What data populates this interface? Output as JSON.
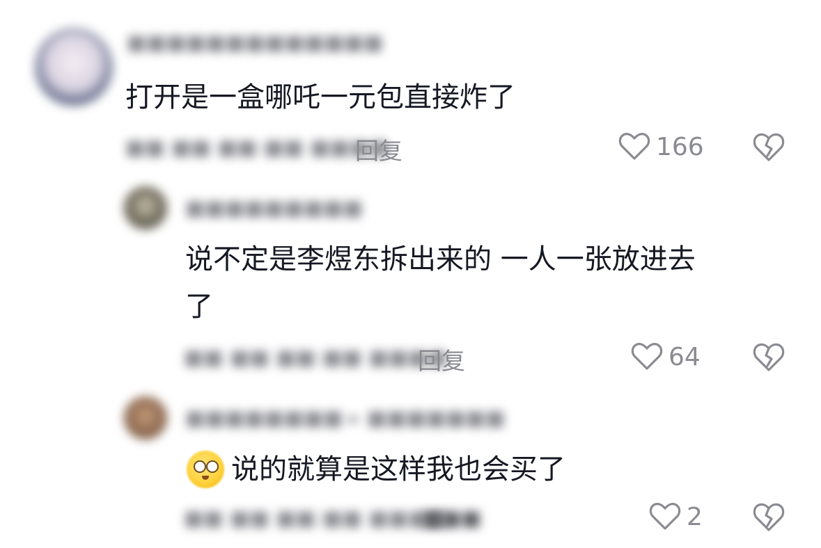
{
  "colors": {
    "text_primary": "#161823",
    "text_secondary": "#8a8b91",
    "background": "#ffffff"
  },
  "comments": [
    {
      "text": "打开是一盒哪吒一元包直接炸了",
      "username_blurred": "■■■■■■■■■■■■■",
      "meta_blurred": "■■ ■■ ■■:■■ ■■■■",
      "reply_label": "回复",
      "like_count": "166",
      "like_icon": "heart-outline-icon",
      "dislike_icon": "broken-heart-icon"
    },
    {
      "text_line1": "说不定是李煜东拆出来的 一人一张放进去",
      "text_line2": "了",
      "username_blurred": "■■■■■■■■■",
      "meta_blurred": "■■ ■■ ■■:■■ ■■■■",
      "reply_label": "回复",
      "like_count": "64",
      "like_icon": "heart-outline-icon",
      "dislike_icon": "broken-heart-icon"
    },
    {
      "emoji": "pleading-face-emoji",
      "text": "说的就算是这样我也会买了",
      "username_blurred": "■■■■■■■■ ▸ ■■■■■■■",
      "meta_blurred": "■■ ■■ ■■:■■ ■■■■",
      "reply_label_blurred": "■■■",
      "like_count": "2",
      "like_icon": "heart-outline-icon",
      "dislike_icon": "broken-heart-icon"
    }
  ]
}
